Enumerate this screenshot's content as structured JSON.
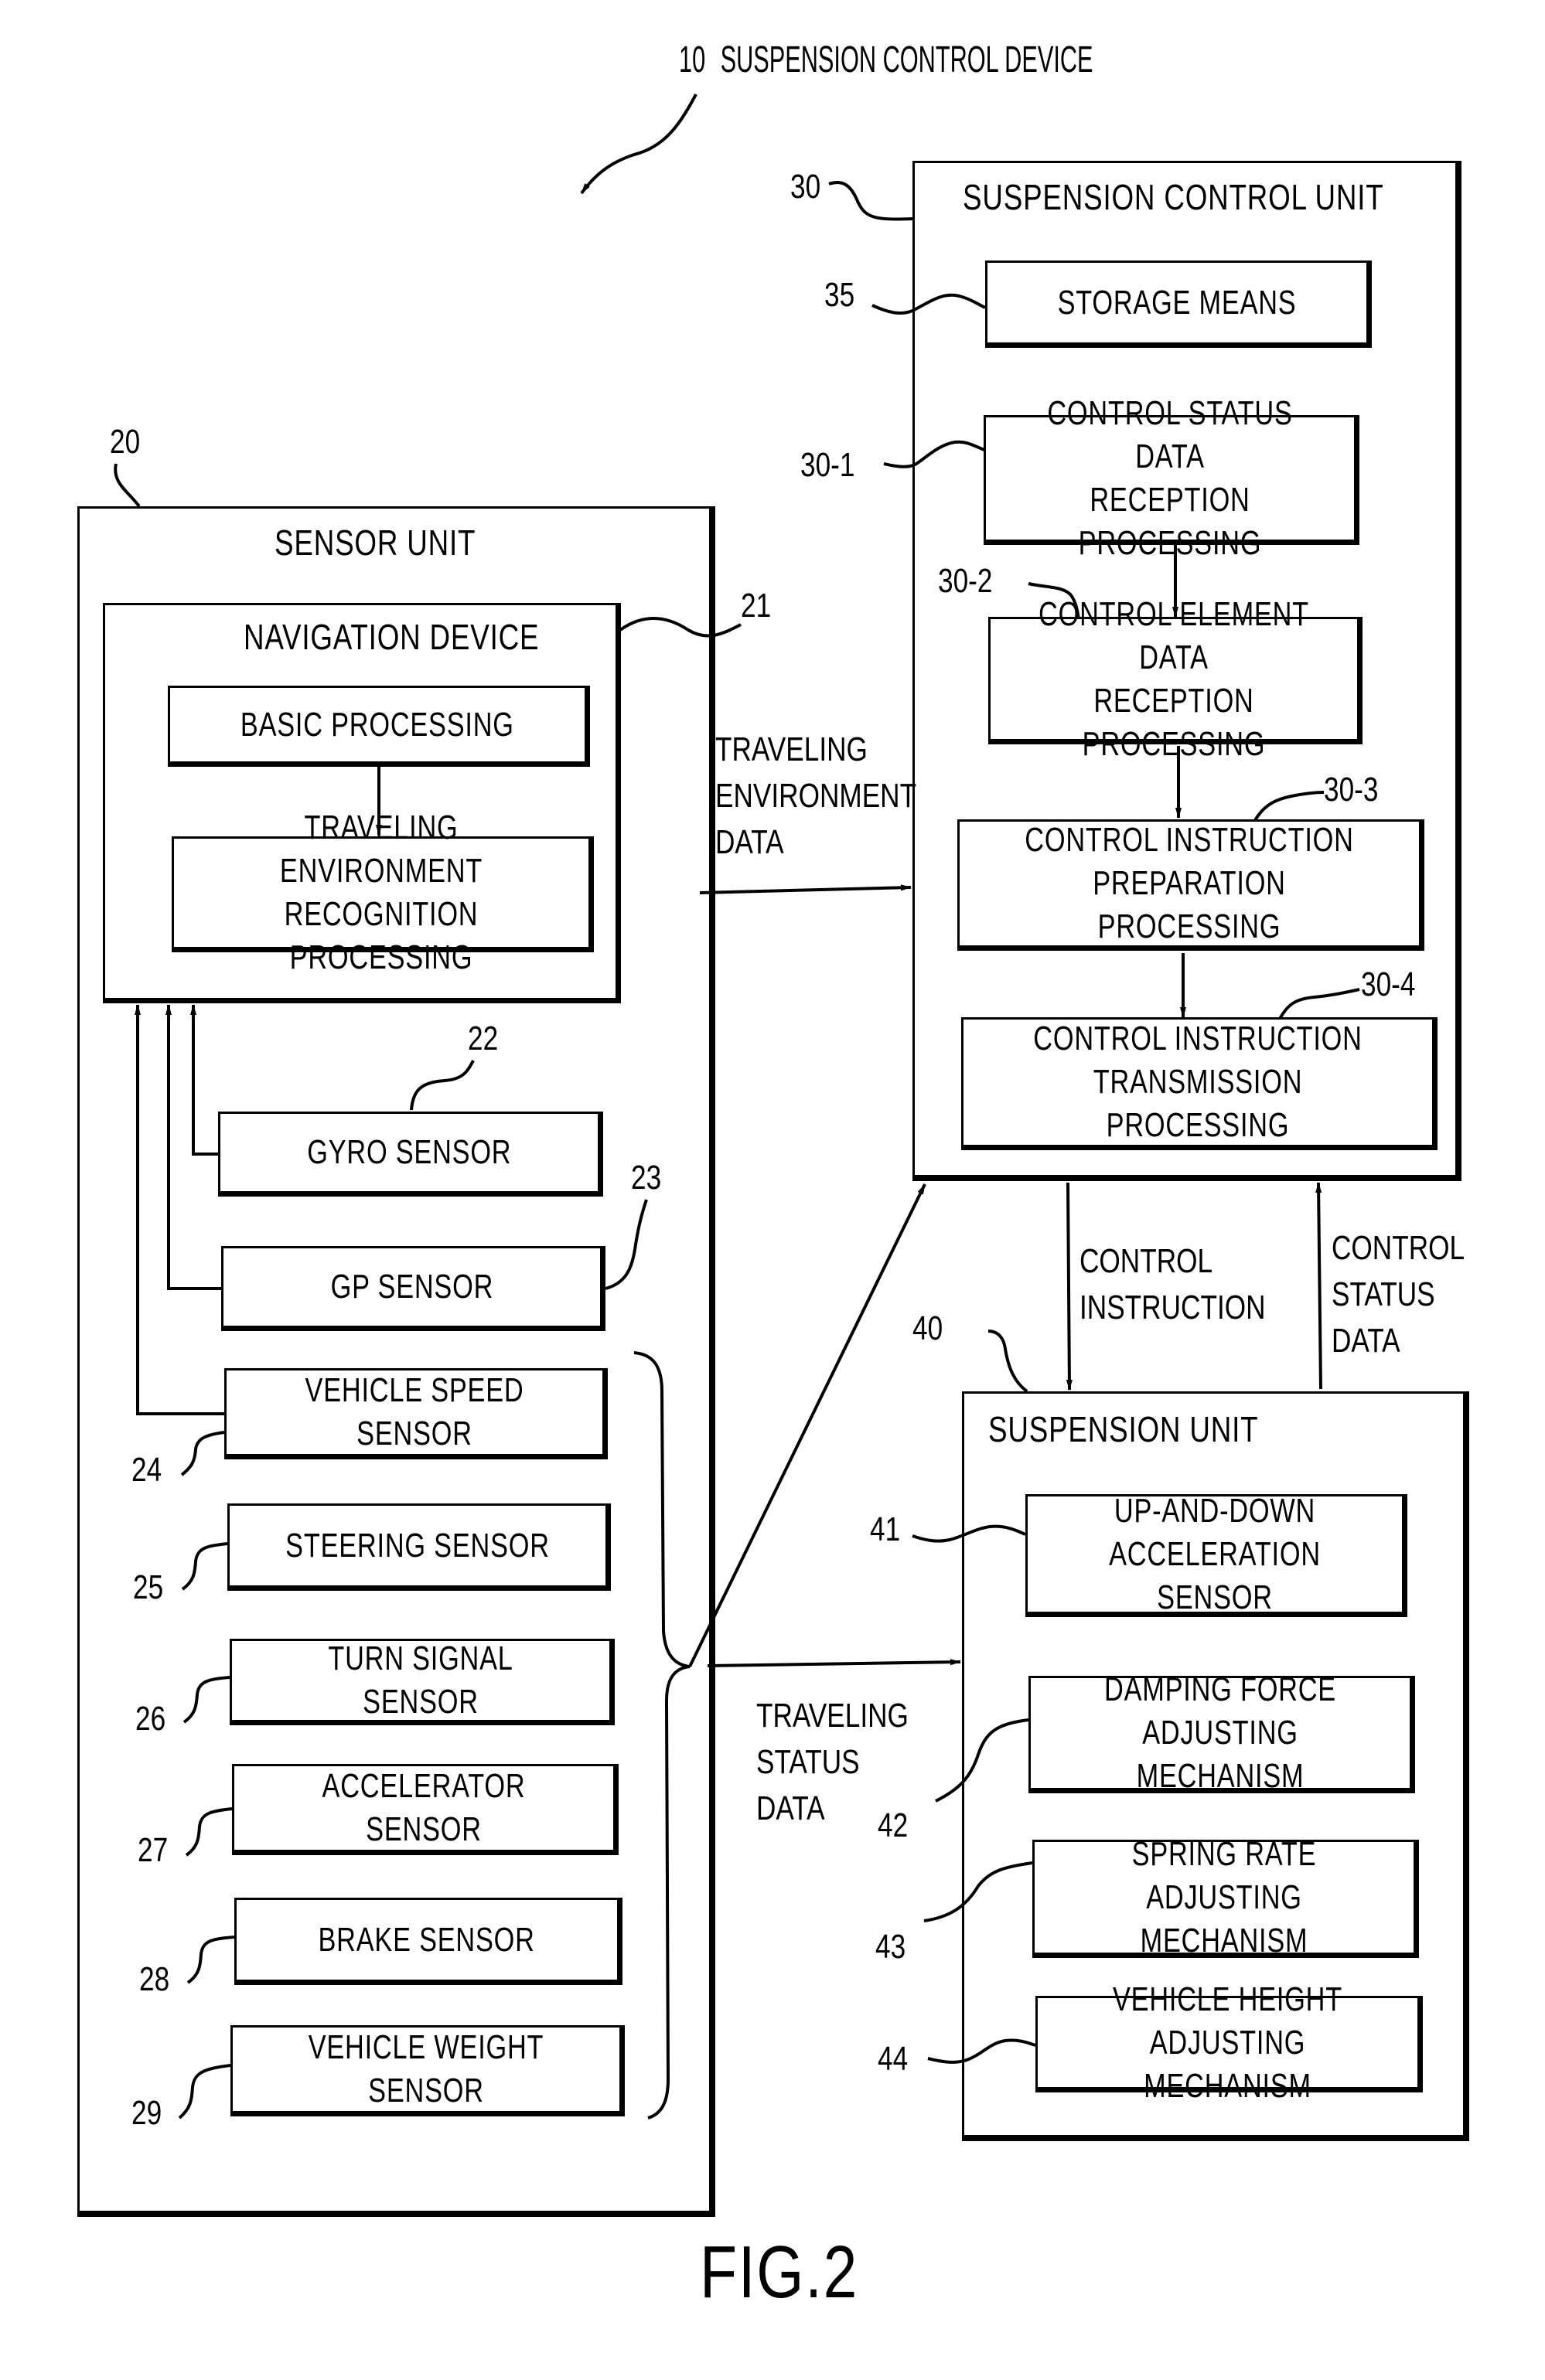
{
  "figure": {
    "title_ref": "10",
    "title": "SUSPENSION CONTROL DEVICE",
    "caption": "FIG.2"
  },
  "sensor_unit": {
    "ref": "20",
    "title": "SENSOR UNIT",
    "navigation_device": {
      "ref": "21",
      "title": "NAVIGATION DEVICE",
      "blocks": [
        {
          "label": "BASIC PROCESSING"
        },
        {
          "label": "TRAVELING ENVIRONMENT\nRECOGNITION PROCESSING"
        }
      ]
    },
    "sensors": [
      {
        "ref": "22",
        "label": "GYRO SENSOR"
      },
      {
        "ref": "23",
        "label": "GP SENSOR"
      },
      {
        "ref": "24",
        "label": "VEHICLE SPEED SENSOR"
      },
      {
        "ref": "25",
        "label": "STEERING SENSOR"
      },
      {
        "ref": "26",
        "label": "TURN SIGNAL SENSOR"
      },
      {
        "ref": "27",
        "label": "ACCELERATOR SENSOR"
      },
      {
        "ref": "28",
        "label": "BRAKE SENSOR"
      },
      {
        "ref": "29",
        "label": "VEHICLE WEIGHT SENSOR"
      }
    ]
  },
  "suspension_control_unit": {
    "ref": "30",
    "title": "SUSPENSION CONTROL UNIT",
    "storage": {
      "ref": "35",
      "label": "STORAGE MEANS"
    },
    "steps": [
      {
        "ref": "30-1",
        "label": "CONTROL STATUS DATA\nRECEPTION PROCESSING"
      },
      {
        "ref": "30-2",
        "label": "CONTROL ELEMENT DATA\nRECEPTION PROCESSING"
      },
      {
        "ref": "30-3",
        "label": "CONTROL INSTRUCTION\nPREPARATION PROCESSING"
      },
      {
        "ref": "30-4",
        "label": "CONTROL INSTRUCTION\nTRANSMISSION PROCESSING"
      }
    ]
  },
  "suspension_unit": {
    "ref": "40",
    "title": "SUSPENSION UNIT",
    "components": [
      {
        "ref": "41",
        "label": "UP-AND-DOWN\nACCELERATION SENSOR"
      },
      {
        "ref": "42",
        "label": "DAMPING FORCE\nADJUSTING MECHANISM"
      },
      {
        "ref": "43",
        "label": "SPRING RATE\nADJUSTING MECHANISM"
      },
      {
        "ref": "44",
        "label": "VEHICLE HEIGHT\nADJUSTING MECHANISM"
      }
    ]
  },
  "flows": {
    "traveling_environment_data": "TRAVELING\nENVIRONMENT\nDATA",
    "traveling_status_data": "TRAVELING\nSTATUS\nDATA",
    "control_instruction": "CONTROL\nINSTRUCTION",
    "control_status_data": "CONTROL\nSTATUS\nDATA"
  }
}
